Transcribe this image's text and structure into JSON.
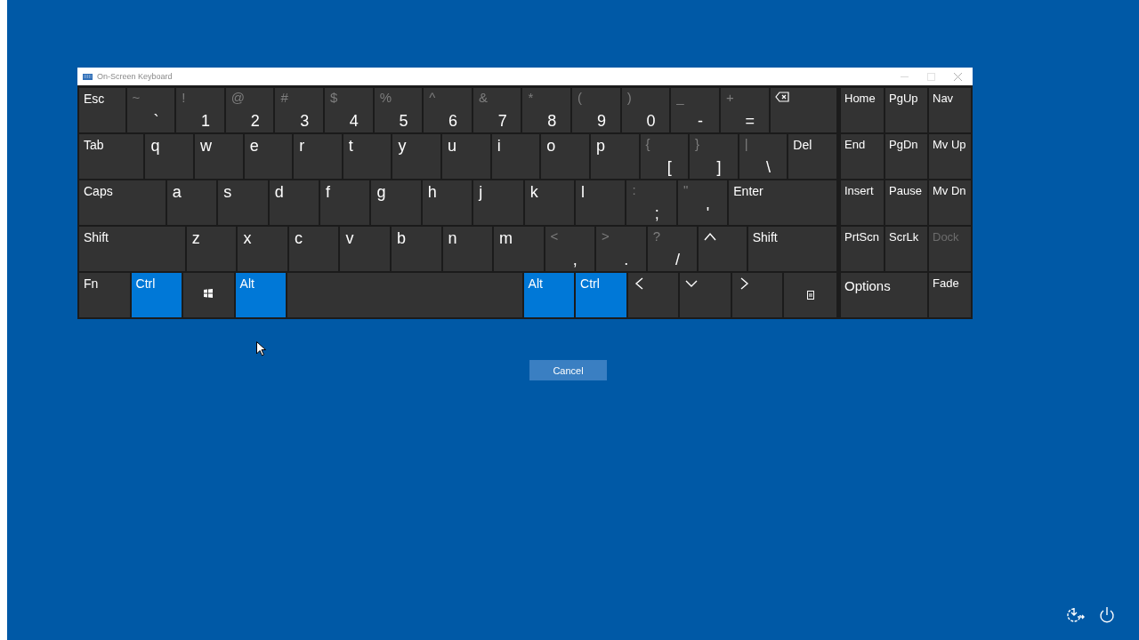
{
  "window": {
    "title": "On-Screen Keyboard"
  },
  "main_keys": [
    [
      {
        "kind": "text",
        "label": "Esc",
        "pressed": false
      },
      {
        "kind": "dual",
        "shift": "~",
        "label": "`",
        "pressed": false
      },
      {
        "kind": "dual",
        "shift": "!",
        "label": "1",
        "pressed": false
      },
      {
        "kind": "dual",
        "shift": "@",
        "label": "2",
        "pressed": false
      },
      {
        "kind": "dual",
        "shift": "#",
        "label": "3",
        "pressed": false
      },
      {
        "kind": "dual",
        "shift": "$",
        "label": "4",
        "pressed": false
      },
      {
        "kind": "dual",
        "shift": "%",
        "label": "5",
        "pressed": false
      },
      {
        "kind": "dual",
        "shift": "^",
        "label": "6",
        "pressed": false
      },
      {
        "kind": "dual",
        "shift": "&",
        "label": "7",
        "pressed": false
      },
      {
        "kind": "dual",
        "shift": "*",
        "label": "8",
        "pressed": false
      },
      {
        "kind": "dual",
        "shift": "(",
        "label": "9",
        "pressed": false
      },
      {
        "kind": "dual",
        "shift": ")",
        "label": "0",
        "pressed": false
      },
      {
        "kind": "dual",
        "shift": "_",
        "label": "-",
        "pressed": false
      },
      {
        "kind": "dual",
        "shift": "+",
        "label": "=",
        "pressed": false
      },
      {
        "kind": "backspace",
        "pressed": false
      }
    ],
    [
      {
        "kind": "text",
        "label": "Tab",
        "pressed": false
      },
      {
        "kind": "char",
        "label": "q",
        "pressed": false
      },
      {
        "kind": "char",
        "label": "w",
        "pressed": false
      },
      {
        "kind": "char",
        "label": "e",
        "pressed": false
      },
      {
        "kind": "char",
        "label": "r",
        "pressed": false
      },
      {
        "kind": "char",
        "label": "t",
        "pressed": false
      },
      {
        "kind": "char",
        "label": "y",
        "pressed": false
      },
      {
        "kind": "char",
        "label": "u",
        "pressed": false
      },
      {
        "kind": "char",
        "label": "i",
        "pressed": false
      },
      {
        "kind": "char",
        "label": "o",
        "pressed": false
      },
      {
        "kind": "char",
        "label": "p",
        "pressed": false
      },
      {
        "kind": "dual",
        "shift": "{",
        "label": "[",
        "pressed": false
      },
      {
        "kind": "dual",
        "shift": "}",
        "label": "]",
        "pressed": false
      },
      {
        "kind": "dual",
        "shift": "|",
        "label": "\\",
        "pressed": false
      },
      {
        "kind": "text",
        "label": "Del",
        "pressed": false
      }
    ],
    [
      {
        "kind": "text",
        "label": "Caps",
        "pressed": false
      },
      {
        "kind": "char",
        "label": "a",
        "pressed": false
      },
      {
        "kind": "char",
        "label": "s",
        "pressed": false
      },
      {
        "kind": "char",
        "label": "d",
        "pressed": false
      },
      {
        "kind": "char",
        "label": "f",
        "pressed": false
      },
      {
        "kind": "char",
        "label": "g",
        "pressed": false
      },
      {
        "kind": "char",
        "label": "h",
        "pressed": false
      },
      {
        "kind": "char",
        "label": "j",
        "pressed": false
      },
      {
        "kind": "char",
        "label": "k",
        "pressed": false
      },
      {
        "kind": "char",
        "label": "l",
        "pressed": false
      },
      {
        "kind": "dual",
        "shift": ":",
        "label": ";",
        "pressed": false
      },
      {
        "kind": "dual",
        "shift": "\"",
        "label": "'",
        "pressed": false
      },
      {
        "kind": "text",
        "label": "Enter",
        "pressed": false
      }
    ],
    [
      {
        "kind": "text",
        "label": "Shift",
        "pressed": false
      },
      {
        "kind": "char",
        "label": "z",
        "pressed": false
      },
      {
        "kind": "char",
        "label": "x",
        "pressed": false
      },
      {
        "kind": "char",
        "label": "c",
        "pressed": false
      },
      {
        "kind": "char",
        "label": "v",
        "pressed": false
      },
      {
        "kind": "char",
        "label": "b",
        "pressed": false
      },
      {
        "kind": "char",
        "label": "n",
        "pressed": false
      },
      {
        "kind": "char",
        "label": "m",
        "pressed": false
      },
      {
        "kind": "dual",
        "shift": "<",
        "label": ",",
        "pressed": false
      },
      {
        "kind": "dual",
        "shift": ">",
        "label": ".",
        "pressed": false
      },
      {
        "kind": "dual",
        "shift": "?",
        "label": "/",
        "pressed": false
      },
      {
        "kind": "up",
        "pressed": false
      },
      {
        "kind": "text",
        "label": "Shift",
        "pressed": false
      }
    ],
    [
      {
        "kind": "text",
        "label": "Fn",
        "pressed": false
      },
      {
        "kind": "text",
        "label": "Ctrl",
        "pressed": true
      },
      {
        "kind": "windows",
        "pressed": false
      },
      {
        "kind": "text",
        "label": "Alt",
        "pressed": true
      },
      {
        "kind": "space",
        "pressed": false
      },
      {
        "kind": "text",
        "label": "Alt",
        "pressed": true
      },
      {
        "kind": "text",
        "label": "Ctrl",
        "pressed": true
      },
      {
        "kind": "left",
        "pressed": false
      },
      {
        "kind": "down",
        "pressed": false
      },
      {
        "kind": "right",
        "pressed": false
      },
      {
        "kind": "menu",
        "pressed": false
      }
    ]
  ],
  "side_keys": [
    {
      "label": "Home",
      "disabled": false
    },
    {
      "label": "PgUp",
      "disabled": false
    },
    {
      "label": "Nav",
      "disabled": false
    },
    {
      "label": "End",
      "disabled": false
    },
    {
      "label": "PgDn",
      "disabled": false
    },
    {
      "label": "Mv Up",
      "disabled": false
    },
    {
      "label": "Insert",
      "disabled": false
    },
    {
      "label": "Pause",
      "disabled": false
    },
    {
      "label": "Mv Dn",
      "disabled": false
    },
    {
      "label": "PrtScn",
      "disabled": false
    },
    {
      "label": "ScrLk",
      "disabled": false
    },
    {
      "label": "Dock",
      "disabled": true
    },
    {
      "label": "Options",
      "disabled": false
    },
    {
      "label": "Fade",
      "disabled": false
    }
  ],
  "cancel_button": "Cancel"
}
